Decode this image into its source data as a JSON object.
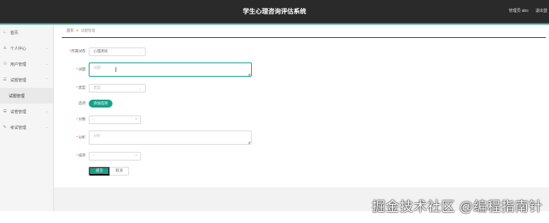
{
  "header": {
    "title": "学生心理咨询评估系统",
    "user": "管理员 abo",
    "logout": "退出登"
  },
  "sidebar": {
    "items": [
      {
        "icon": "home-icon",
        "glyph": "⌂",
        "label": "首页",
        "arrow": ""
      },
      {
        "icon": "person-icon",
        "glyph": "♙",
        "label": "个人中心",
        "arrow": "⌄"
      },
      {
        "icon": "users-icon",
        "glyph": "⚇",
        "label": "用户管理",
        "arrow": "⌄"
      },
      {
        "icon": "list-icon",
        "glyph": "☷",
        "label": "试题管理",
        "arrow": "⌃"
      },
      {
        "icon": "",
        "glyph": "",
        "label": "试题管理",
        "arrow": ""
      },
      {
        "icon": "grid-icon",
        "glyph": "☰",
        "label": "试卷管理",
        "arrow": "⌄"
      },
      {
        "icon": "exam-icon",
        "glyph": "✎",
        "label": "考试管理",
        "arrow": "⌄"
      }
    ]
  },
  "breadcrumb": {
    "home": "首页",
    "current": "试题管理"
  },
  "form": {
    "paper": {
      "label": "所属试卷",
      "value": "心理测试"
    },
    "question": {
      "label": "试题",
      "placeholder": "试题"
    },
    "type": {
      "label": "类型",
      "placeholder": "类型"
    },
    "options": {
      "label": "选项",
      "button": "添加选项"
    },
    "score": {
      "label": "分数",
      "minus": "−",
      "plus": "+"
    },
    "analysis": {
      "label": "分析",
      "placeholder": "分析"
    },
    "sort": {
      "label": "排序",
      "minus": "−",
      "plus": "+"
    },
    "submit": "提交",
    "cancel": "取消"
  },
  "watermark": "掘金技术社区 @编程指南针"
}
